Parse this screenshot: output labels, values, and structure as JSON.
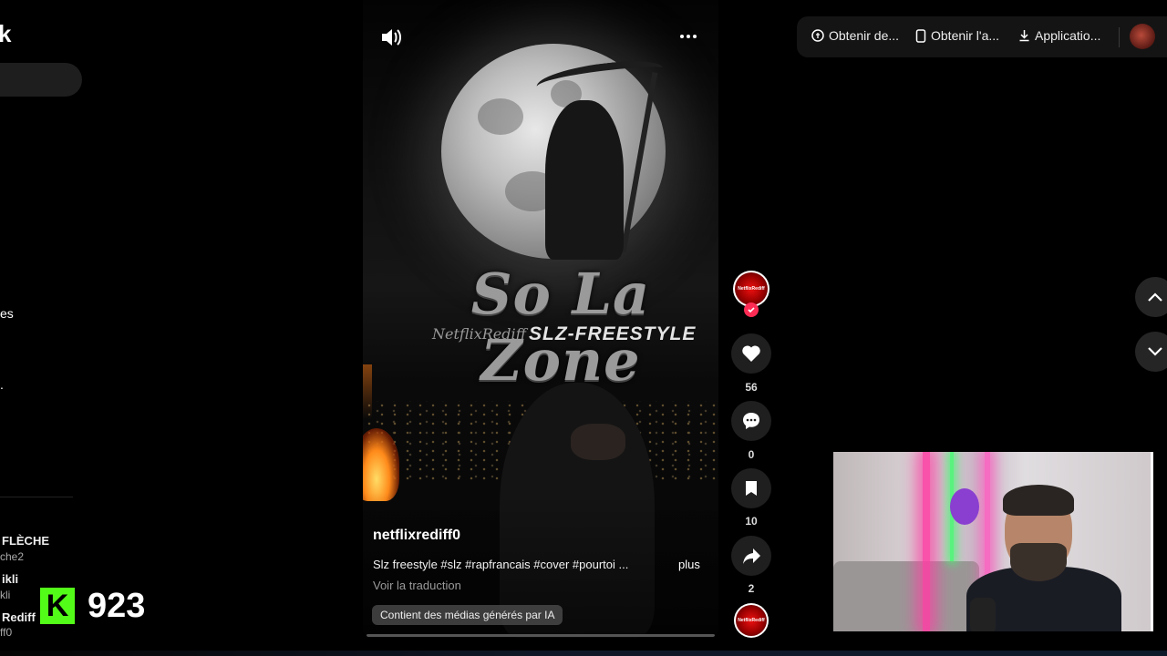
{
  "sidebar": {
    "logo_fragment": "k",
    "fragments": [
      "es",
      "."
    ],
    "following": [
      {
        "name": "FLÈCHE",
        "handle": "che2"
      },
      {
        "name": "ikli",
        "handle": "kli"
      },
      {
        "name": "Rediff",
        "handle": "ff0"
      }
    ]
  },
  "kick_overlay": {
    "logo_letter": "K",
    "viewer_count": "923",
    "brand_color": "#53fc18"
  },
  "video": {
    "artwork_title": "So La Zone",
    "watermark": "NetflixRediff",
    "overlay_subtitle": "SLZ-FREESTYLE",
    "author": "netflixrediff0",
    "caption": "Slz freestyle #slz #rapfrancais  #cover  #pourtoi ...",
    "caption_more": "plus",
    "translate_link": "Voir la traduction",
    "ai_label": "Contient des médias générés par IA",
    "sound_icon": "speaker-icon",
    "more_icon": "more-dots-icon"
  },
  "actions": {
    "avatar_text": "NetflixRediff",
    "likes": "56",
    "comments": "0",
    "saves": "10",
    "shares": "2",
    "accent_color": "#fe2c55"
  },
  "topbar": {
    "items": [
      {
        "label": "Obtenir de...",
        "icon": "coin-icon"
      },
      {
        "label": "Obtenir l'a...",
        "icon": "phone-icon"
      },
      {
        "label": "Applicatio...",
        "icon": "download-icon"
      }
    ]
  }
}
